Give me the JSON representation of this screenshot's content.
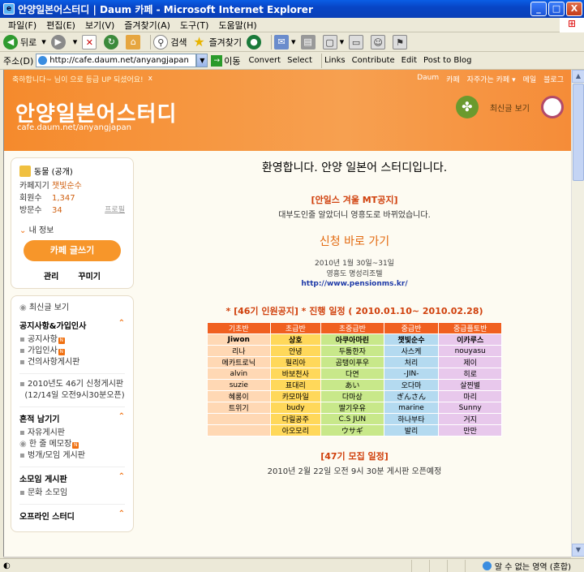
{
  "window": {
    "title": "안양일본어스터디 | Daum 카페 - Microsoft Internet Explorer",
    "min": "_",
    "max": "□",
    "close": "X"
  },
  "menu": [
    "파일(F)",
    "편집(E)",
    "보기(V)",
    "즐겨찾기(A)",
    "도구(T)",
    "도움말(H)"
  ],
  "toolbar": {
    "back": "뒤로",
    "search": "검색",
    "favorites": "즐겨찾기"
  },
  "address": {
    "label": "주소(D)",
    "url": "http://cafe.daum.net/anyangjapan",
    "go": "이동",
    "convert": "Convert",
    "select": "Select",
    "links": "Links",
    "contribute": "Contribute",
    "edit": "Edit",
    "post": "Post to Blog"
  },
  "cafe": {
    "notice": "축하합니다~         님이          으로 등급 UP 되셨어요!",
    "notice_close": "x",
    "top_links": [
      "Daum",
      "카페",
      "자주가는 카페 ▾",
      "메일",
      "블로그"
    ],
    "title": "안양일본어스터디",
    "url": "cafe.daum.net/anyangjapan",
    "recent_label": "최신글 보기"
  },
  "sidebar": {
    "rank": "동물 (공개)",
    "info": [
      {
        "k": "카페지기",
        "v": "챗빛순수"
      },
      {
        "k": "회원수",
        "v": "1,347"
      },
      {
        "k": "방문수",
        "v": "34"
      }
    ],
    "profile": "프로필",
    "my_info": "내 정보",
    "write_button": "카페 글쓰기",
    "manage": "관리",
    "decorate": "꾸미기",
    "recent": "최신글 보기",
    "sections": [
      {
        "title": "공지사항&가입인사",
        "items": [
          "공지사항",
          "가입인사",
          "건의사항게시판"
        ]
      },
      {
        "title": "",
        "items": [
          "2010년도 46기 신청게시판",
          "(12/14일 오전9시30분오픈)"
        ]
      },
      {
        "title": "흔적 남기기",
        "items": [
          "자유게시판",
          "한 줄 메모장",
          "벙개/모임 게시판"
        ]
      },
      {
        "title": "소모임 게시판",
        "items": [
          "문화 소모임"
        ]
      },
      {
        "title": "오프라인 스터디",
        "items": []
      }
    ]
  },
  "main": {
    "welcome": "환영합니다. 안양 일본어 스터디입니다.",
    "mt_title": "[안일스 겨울 MT공지]",
    "mt_text": "대부도인줄 알았더니 영흥도로 바뀌었습니다.",
    "apply": "신청 바로 가기",
    "date": "2010년 1월 30일~31일",
    "place": "영흥도 명성리조텔",
    "link": "http://www.pensionms.kr/",
    "sched_title": "* [46기 인원공지] *  진행 일정 ( 2010.01.10~ 2010.02.28)",
    "table_headers": [
      "기초반",
      "초급반",
      "초중급반",
      "중급반",
      "중급플토반"
    ],
    "table_rows": [
      [
        "Jiwon",
        "상호",
        "아쿠아마린",
        "챗빛순수",
        "이카루스"
      ],
      [
        "리나",
        "안녕",
        "두툼한자",
        "사스케",
        "nouyasu"
      ],
      [
        "메카트로닉",
        "필리아",
        "곰탱이푸우",
        "처리",
        "제이"
      ],
      [
        "alvin",
        "바보천사",
        "다연",
        "-JIN-",
        "히로"
      ],
      [
        "suzie",
        "표대리",
        "あい",
        "오다마",
        "살찐별"
      ],
      [
        "혜롱이",
        "카모마일",
        "다마상",
        "ぎんさん",
        "마리"
      ],
      [
        "트위기",
        "budy",
        "딸기우유",
        "marine",
        "Sunny"
      ],
      [
        "",
        "다릴공주",
        "C.S JUN",
        "하나부타",
        "거지"
      ],
      [
        "",
        "아오모리",
        "ウサギ",
        "발리",
        "만만"
      ]
    ],
    "sched2_title": "[47기 모집 일정]",
    "sched2_text": "2010년 2월 22일 오전 9시 30분 게시판 오픈예정"
  },
  "status": {
    "zone": "알 수 없는 영역 (혼합)"
  }
}
